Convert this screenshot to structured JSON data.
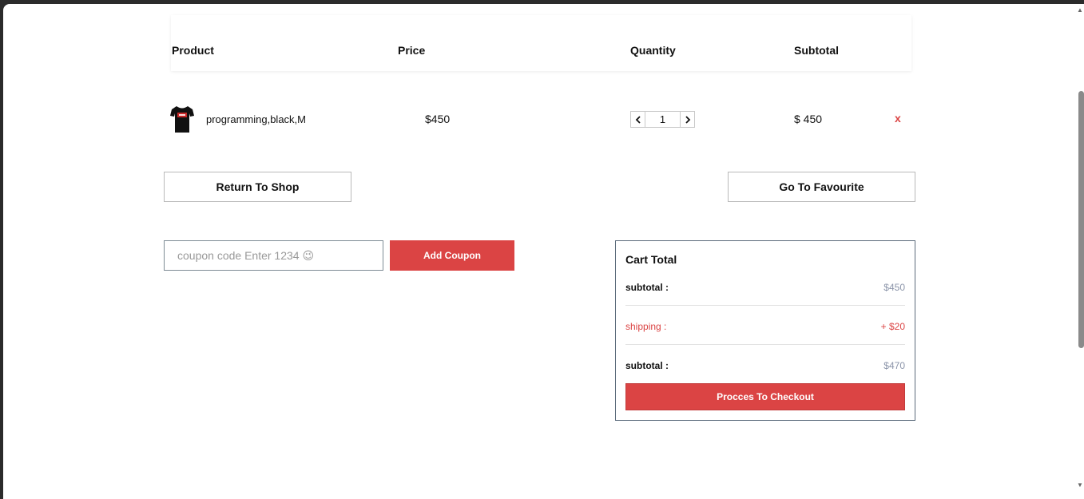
{
  "table_header": {
    "product": "Product",
    "price": "Price",
    "quantity": "Quantity",
    "subtotal": "Subtotal"
  },
  "cart_items": [
    {
      "name": "programming,black,M",
      "price": "$450",
      "quantity": "1",
      "subtotal": "$ 450",
      "remove_label": "x",
      "thumbnail_icon": "black-tshirt-icon"
    }
  ],
  "actions": {
    "return_label": "Return To Shop",
    "favourite_label": "Go To Favourite"
  },
  "coupon": {
    "placeholder": "coupon code Enter 1234 😉",
    "button_label": "Add Coupon"
  },
  "cart_total": {
    "title": "Cart Total",
    "subtotal_label": "subtotal :",
    "subtotal_value": "$450",
    "shipping_label": "shipping :",
    "shipping_value": "+ $20",
    "total_label": "subtotal :",
    "total_value": "$470",
    "checkout_label": "Procces To Checkout"
  },
  "colors": {
    "accent": "#db4444",
    "muted_value": "#8a93a8"
  }
}
